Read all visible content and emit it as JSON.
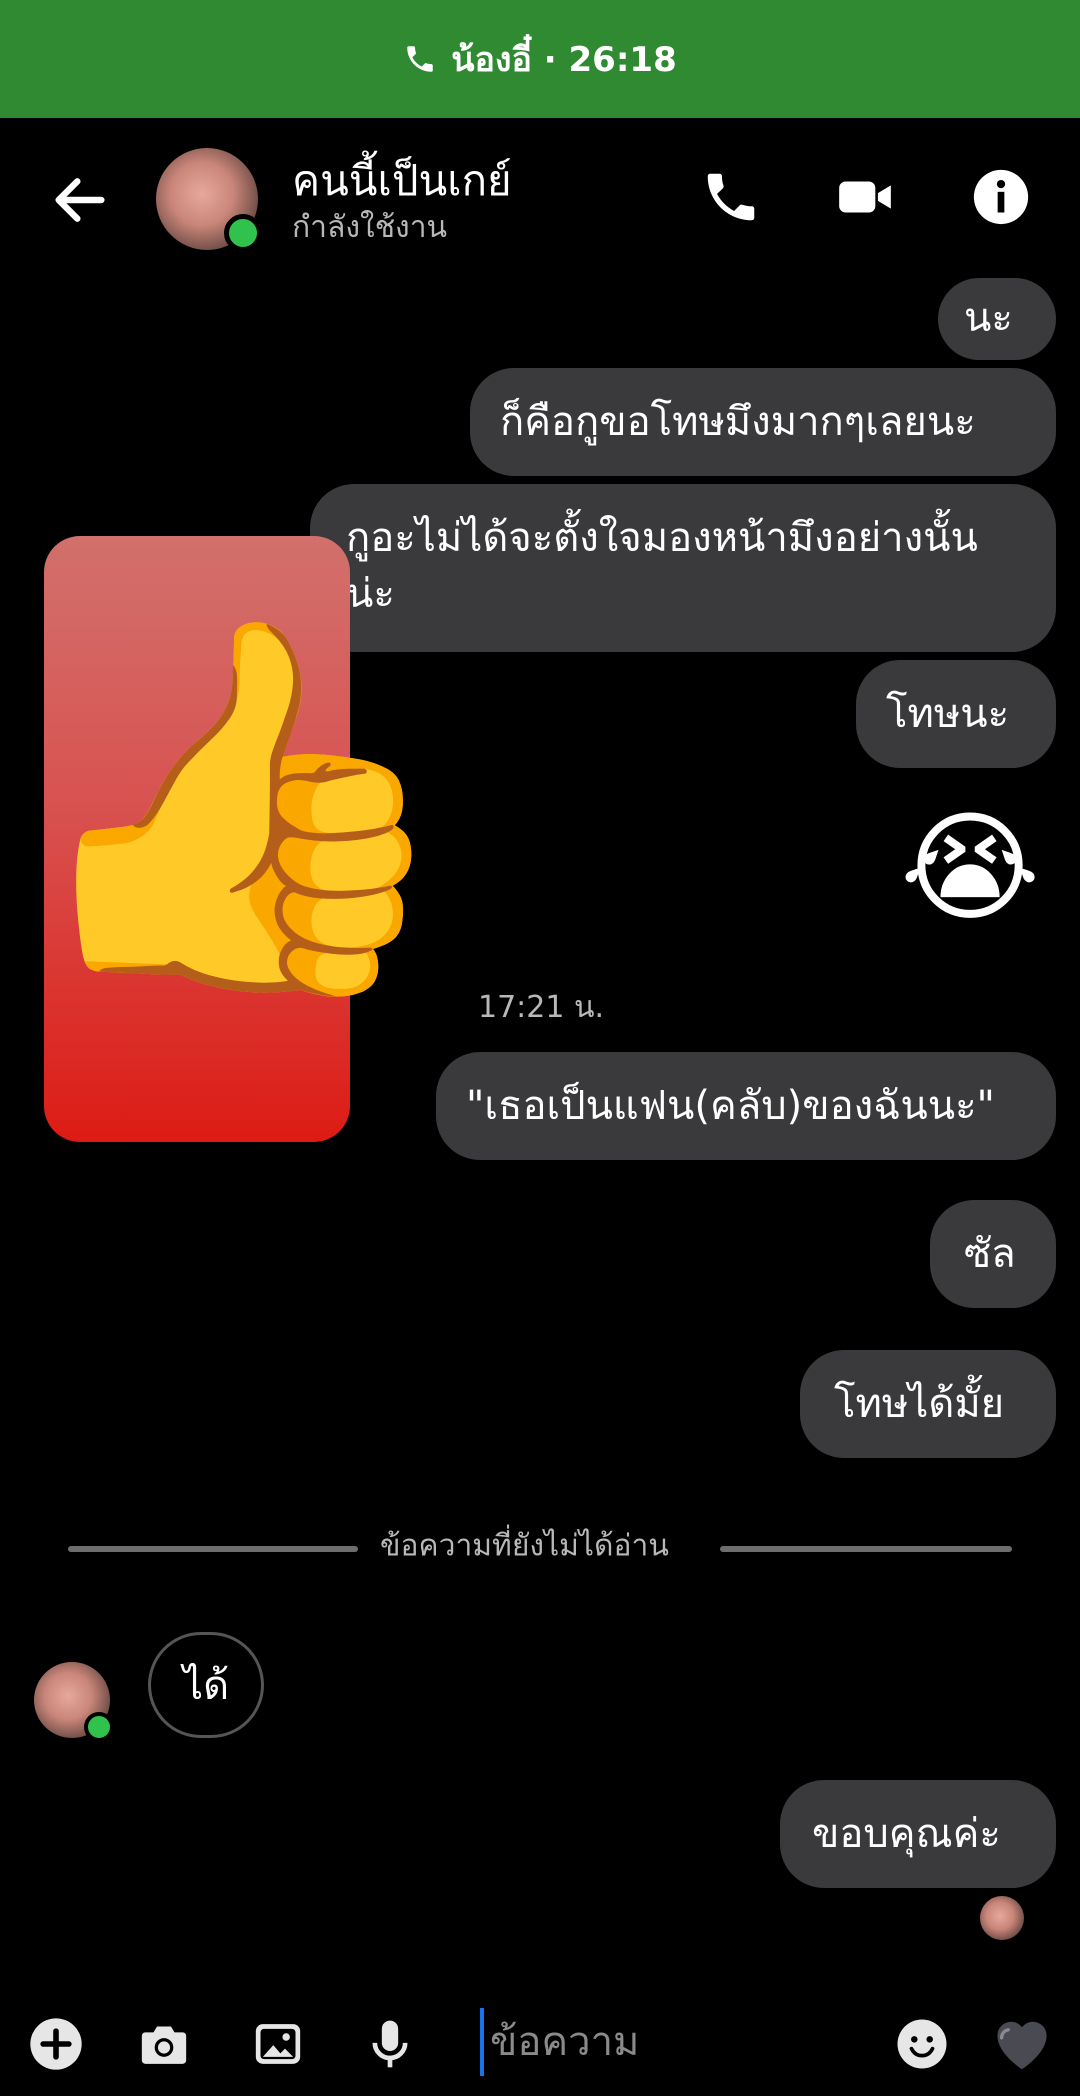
{
  "call_banner": {
    "text": "น้องอี๋ · 26:18",
    "color": "#2f8a32",
    "icon": "phone-icon"
  },
  "header": {
    "contact_name": "คนนี้เป็นเกย์",
    "status": "กำลังใช้งาน",
    "icons": [
      "back-arrow-icon",
      "phone-icon",
      "video-icon",
      "info-icon"
    ]
  },
  "messages": {
    "m1": "นะ",
    "m2": "ก็คือกูขอโทษมึงมากๆเลยนะ",
    "m3": "กูอะไม่ได้จะตั้งใจมองหน้ามึงอย่างนั้นน่ะ",
    "m4": "โทษนะ",
    "m5_emoji": "😭",
    "sticker": "👍",
    "timestamp": "17:21 น.",
    "m6": "\"เธอเป็นแฟน(คลับ)ของฉันนะ\"",
    "m7": "ซัล",
    "m8": "โทษได้มั้ย",
    "unread_divider": "ข้อความที่ยังไม่ได้อ่าน",
    "received": "ได้",
    "m9": "ขอบคุณค่ะ"
  },
  "composer": {
    "placeholder": "ข้อความ",
    "icons": [
      "plus-icon",
      "camera-icon",
      "image-icon",
      "mic-icon",
      "emoji-icon",
      "heart-icon"
    ]
  },
  "colors": {
    "bubble": "#3a3a3c",
    "online": "#31c24d",
    "background": "#000000"
  }
}
